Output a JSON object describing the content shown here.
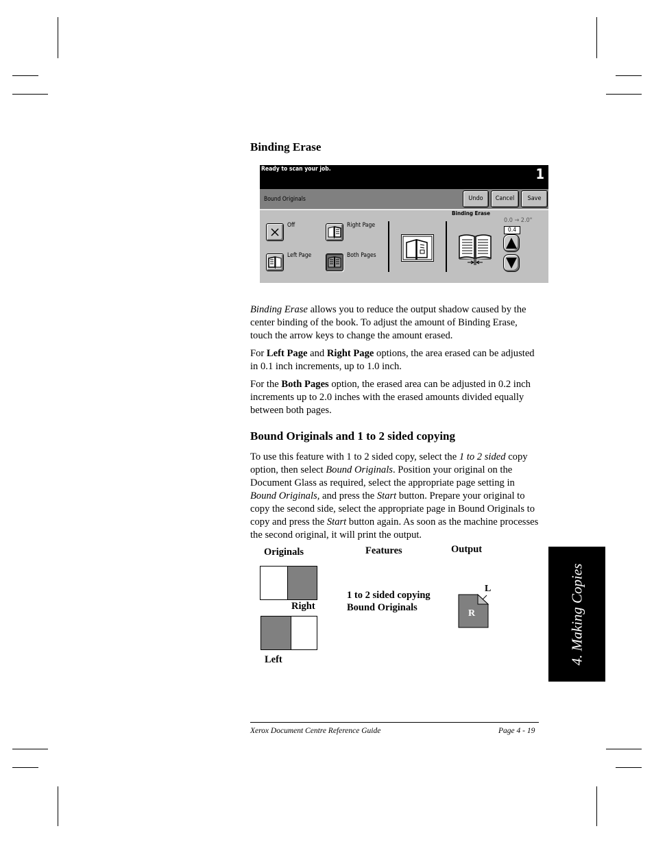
{
  "section1": {
    "heading": "Binding Erase"
  },
  "panel": {
    "status_message": "Ready to scan your job.",
    "copy_count": "1",
    "feature_title": "Bound Originals",
    "buttons": {
      "undo": "Undo",
      "cancel": "Cancel",
      "save": "Save"
    },
    "options": [
      {
        "label": "Off",
        "icon": "x-icon",
        "selected": false
      },
      {
        "label": "Right Page",
        "icon": "right-page-book-icon",
        "selected": false
      },
      {
        "label": "Left Page",
        "icon": "left-page-book-icon",
        "selected": false
      },
      {
        "label": "Both Pages",
        "icon": "both-pages-book-icon",
        "selected": true
      }
    ],
    "binding_erase": {
      "label": "Binding Erase",
      "range": "0.0 → 2.0\"",
      "value": "0.4",
      "up_icon": "up-arrow-icon",
      "down_icon": "down-arrow-icon"
    }
  },
  "paragraphs": {
    "p1": {
      "italic_lead": "Binding Erase",
      "rest": " allows you to reduce the output shadow caused by the center binding of the book. To adjust the amount of Binding Erase, touch the arrow keys to change the amount erased."
    },
    "p2": {
      "t1": "For ",
      "b1": "Left Page",
      "t2": " and ",
      "b2": "Right Page",
      "t3": " options, the area erased can be adjusted in 0.1 inch increments, up to 1.0 inch."
    },
    "p3": {
      "t1": "For the ",
      "b1": "Both Pages",
      "t2": " option, the erased area can be adjusted in 0.2 inch increments up to 2.0 inches with the erased amounts divided equally between both pages."
    }
  },
  "section2": {
    "heading": "Bound Originals and 1 to 2 sided copying",
    "paragraph": {
      "t1": "To use this feature with 1 to 2 sided copy, select the ",
      "i1": "1 to 2 sided",
      "t2": " copy option, then select ",
      "i2": "Bound Originals",
      "t3": ". Position your original on the Document Glass as required, select the appropriate page setting in ",
      "i3": "Bound Originals,",
      "t4": " and press the ",
      "i4": "Start",
      "t5": " button. Prepare your original to copy the second side, select the appropriate page in Bound Originals to copy and press the ",
      "i5": "Start",
      "t6": " button again. As soon as the machine processes the second original, it will print the output."
    }
  },
  "diagram": {
    "col_originals": "Originals",
    "col_features": "Features",
    "col_output": "Output",
    "label_right": "Right",
    "label_left": "Left",
    "feature_line1": "1 to 2 sided copying",
    "feature_line2": "Bound Originals",
    "output_front": "R",
    "output_back": "L"
  },
  "side_tab": {
    "label": "4. Making Copies"
  },
  "footer": {
    "left": "Xerox Document Centre Reference Guide",
    "right": "Page 4 - 19"
  }
}
